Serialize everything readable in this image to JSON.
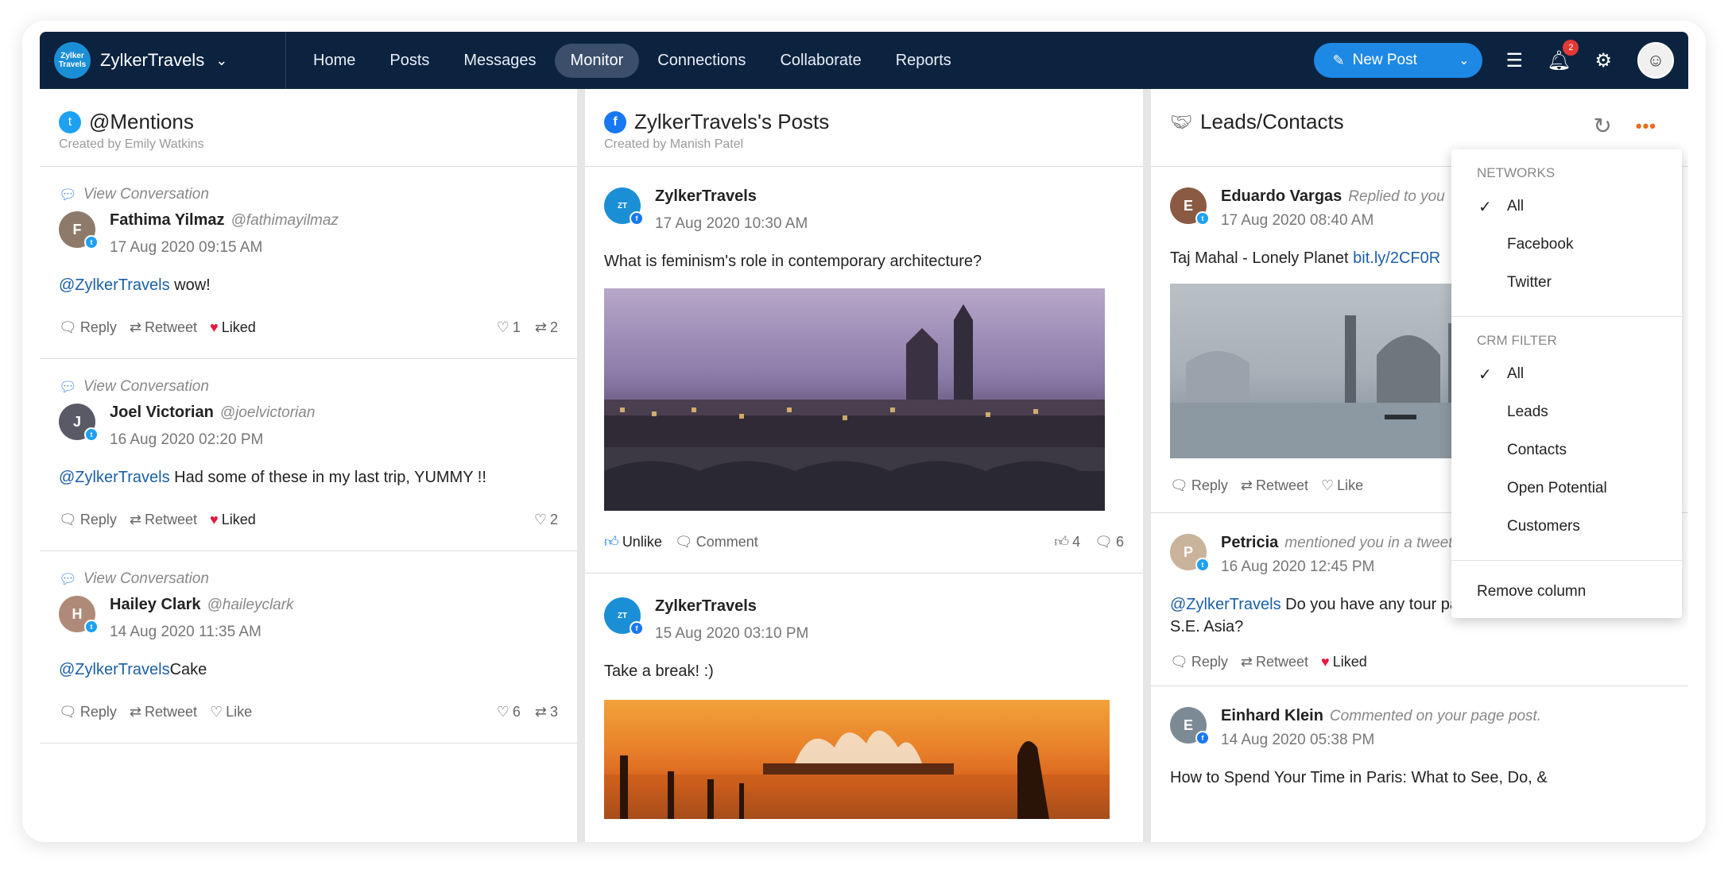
{
  "topbar": {
    "logo_text": "Zylker Travels",
    "brand": "ZylkerTravels",
    "nav": [
      "Home",
      "Posts",
      "Messages",
      "Monitor",
      "Connections",
      "Collaborate",
      "Reports"
    ],
    "active_nav": "Monitor",
    "new_post": "New Post",
    "notification_count": "2"
  },
  "columns": {
    "mentions": {
      "title": "@Mentions",
      "created_by": "Created by Emily Watkins",
      "posts": [
        {
          "view": "View Conversation",
          "name": "Fathima Yilmaz",
          "handle": "@fathimayilmaz",
          "time": "17 Aug 2020 09:15 AM",
          "mention": "@ZylkerTravels",
          "text": " wow!",
          "reply": "Reply",
          "retweet": "Retweet",
          "like": "Liked",
          "likes": "1",
          "retweets": "2"
        },
        {
          "view": "View Conversation",
          "name": "Joel Victorian",
          "handle": "@joelvictorian",
          "time": "16 Aug 2020 02:20 PM",
          "mention": "@ZylkerTravels",
          "text": " Had some of these in my last trip, YUMMY !!",
          "reply": "Reply",
          "retweet": "Retweet",
          "like": "Liked",
          "likes": "2"
        },
        {
          "view": "View Conversation",
          "name": "Hailey Clark",
          "handle": "@haileyclark",
          "time": "14 Aug 2020 11:35 AM",
          "mention": "@ZylkerTravels",
          "text": "Cake",
          "reply": "Reply",
          "retweet": "Retweet",
          "like": "Like",
          "likes": "6",
          "retweets": "3"
        }
      ]
    },
    "posts": {
      "title": "ZylkerTravels's Posts",
      "created_by": "Created by Manish Patel",
      "items": [
        {
          "name": "ZylkerTravels",
          "time": "17 Aug 2020 10:30 AM",
          "text": "What is feminism's role in contemporary architecture?",
          "unlike": "Unlike",
          "comment": "Comment",
          "likes": "4",
          "comments": "6"
        },
        {
          "name": "ZylkerTravels",
          "time": "15 Aug 2020 03:10 PM",
          "text": "Take a break! :)"
        }
      ]
    },
    "leads": {
      "title": "Leads/Contacts",
      "posts": [
        {
          "name": "Eduardo Vargas",
          "action": "Replied to you",
          "time": "17 Aug 2020 08:40 AM",
          "text": "Taj Mahal - Lonely Planet ",
          "link": "bit.ly/2CF0R",
          "reply": "Reply",
          "retweet": "Retweet",
          "like": "Like"
        },
        {
          "name": "Petricia",
          "action": "mentioned you in a tweet",
          "time": "16 Aug 2020 12:45 PM",
          "mention": "@ZylkerTravels",
          "text": " Do you have any tour packages for S.E. Asia?",
          "reply": "Reply",
          "retweet": "Retweet",
          "like": "Liked"
        },
        {
          "name": "Einhard Klein",
          "action": "Commented on your page post.",
          "time": "14 Aug 2020 05:38 PM",
          "text": "How to Spend Your Time in Paris: What to See, Do, &"
        }
      ]
    }
  },
  "dropdown": {
    "networks_label": "NETWORKS",
    "networks": [
      "All",
      "Facebook",
      "Twitter"
    ],
    "crm_label": "CRM FILTER",
    "crm": [
      "All",
      "Leads",
      "Contacts",
      "Open Potential",
      "Customers"
    ],
    "remove": "Remove column"
  },
  "colors": {
    "topbar": "#0c2340",
    "accent": "#1e88e5",
    "more": "#e86c1f",
    "liked": "#e8173e"
  }
}
